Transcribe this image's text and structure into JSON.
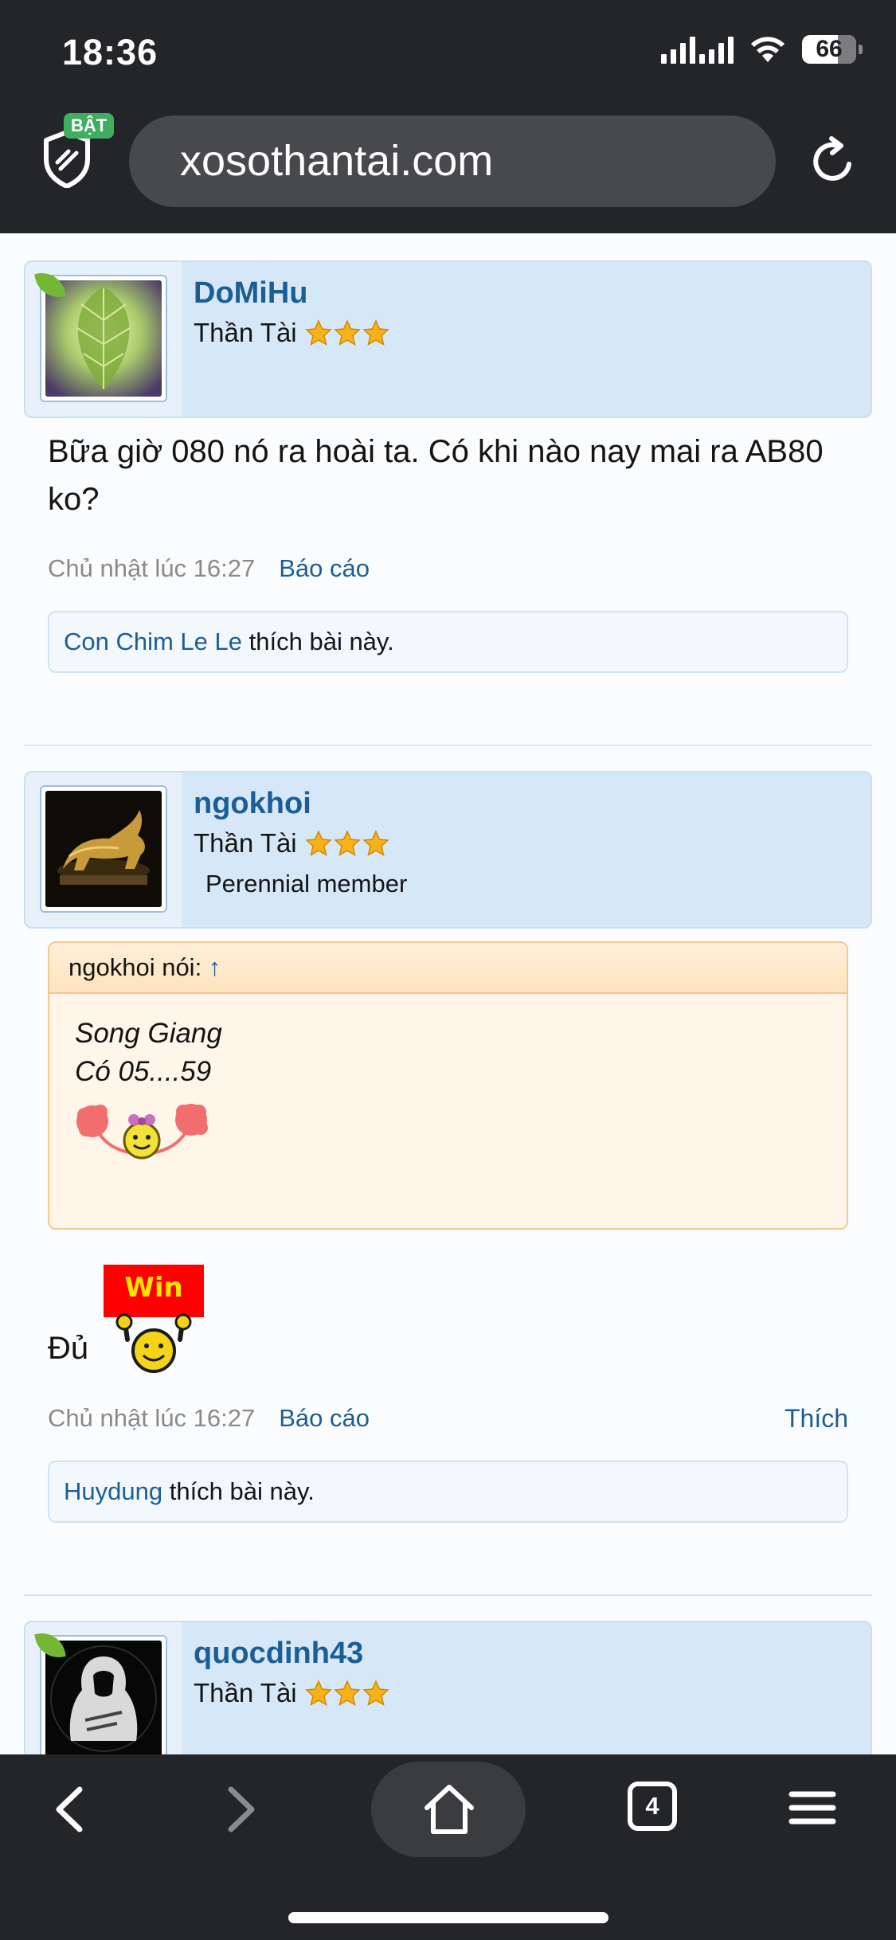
{
  "status_bar": {
    "time": "18:36",
    "battery": "66",
    "battery_level": 0.66
  },
  "browser": {
    "badge": "BẬT",
    "url": "xosothantai.com",
    "tab_count": "4"
  },
  "posts": [
    {
      "username": "DoMiHu",
      "rank": "Thần Tài",
      "rank_stars": 3,
      "message": "Bữa giờ 080 nó ra hoài ta. Có khi nào nay mai ra AB80 ko?",
      "time": "Chủ nhật lúc 16:27",
      "report": "Báo cáo",
      "liker": "Con Chim Le Le",
      "like_text": "thích bài này."
    },
    {
      "username": "ngokhoi",
      "rank": "Thần Tài",
      "rank_stars": 3,
      "user_title": "Perennial member",
      "quote_author": "ngokhoi nói:",
      "quote_arrow": "↑",
      "quote_line1": "Song Giang",
      "quote_line2": "Có 05....59",
      "message": "Đủ",
      "sign_text": "Win",
      "time": "Chủ nhật lúc 16:27",
      "report": "Báo cáo",
      "like_button": "Thích",
      "liker": "Huydung",
      "like_text": "thích bài này."
    },
    {
      "username": "quocdinh43",
      "rank": "Thần Tài",
      "rank_stars": 3
    }
  ],
  "colors": {
    "link": "#1b5e96",
    "user_bar": "#d6e8f8",
    "quote_bg": "#fff5e8",
    "chrome": "#242528"
  }
}
